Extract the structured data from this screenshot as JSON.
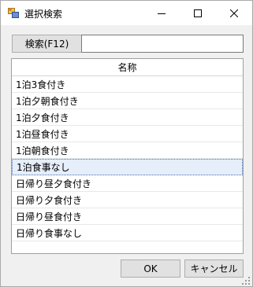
{
  "window": {
    "title": "選択検索",
    "icon": "app-icon",
    "controls": [
      "minimize-icon",
      "maximize-icon",
      "close-icon"
    ]
  },
  "search": {
    "button_label": "検索(F12)",
    "input_value": ""
  },
  "grid": {
    "header": "名称",
    "rows": [
      "1泊3食付き",
      "1泊夕朝食付き",
      "1泊夕食付き",
      "1泊昼食付き",
      "1泊朝食付き",
      "1泊食事なし",
      "日帰り昼夕食付き",
      "日帰り夕食付き",
      "日帰り昼食付き",
      "日帰り食事なし"
    ],
    "selected_row": "1泊食事なし"
  },
  "footer": {
    "ok_label": "OK",
    "cancel_label": "キャンセル"
  },
  "colors": {
    "window_bg": "#f0f0f0",
    "selection_bg": "#e5eef9",
    "selection_border": "#4a6fb5",
    "button_bg": "#e1e1e1"
  }
}
